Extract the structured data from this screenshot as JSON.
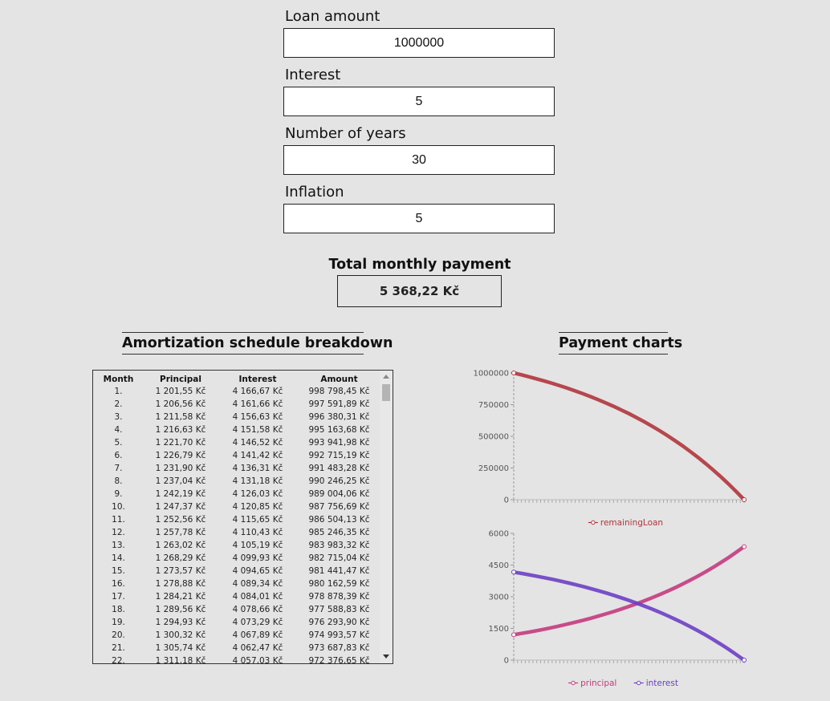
{
  "form": {
    "loan_label": "Loan amount",
    "loan_value": "1000000",
    "interest_label": "Interest",
    "interest_value": "5",
    "years_label": "Number of years",
    "years_value": "30",
    "inflation_label": "Inflation",
    "inflation_value": "5"
  },
  "result": {
    "label": "Total monthly payment",
    "value": "5 368,22 Kč"
  },
  "sections": {
    "amortization_title": "Amortization schedule breakdown",
    "charts_title": "Payment charts"
  },
  "table": {
    "headers": [
      "Month",
      "Principal",
      "Interest",
      "Amount"
    ],
    "rows": [
      [
        "1.",
        "1 201,55 Kč",
        "4 166,67 Kč",
        "998 798,45 Kč"
      ],
      [
        "2.",
        "1 206,56 Kč",
        "4 161,66 Kč",
        "997 591,89 Kč"
      ],
      [
        "3.",
        "1 211,58 Kč",
        "4 156,63 Kč",
        "996 380,31 Kč"
      ],
      [
        "4.",
        "1 216,63 Kč",
        "4 151,58 Kč",
        "995 163,68 Kč"
      ],
      [
        "5.",
        "1 221,70 Kč",
        "4 146,52 Kč",
        "993 941,98 Kč"
      ],
      [
        "6.",
        "1 226,79 Kč",
        "4 141,42 Kč",
        "992 715,19 Kč"
      ],
      [
        "7.",
        "1 231,90 Kč",
        "4 136,31 Kč",
        "991 483,28 Kč"
      ],
      [
        "8.",
        "1 237,04 Kč",
        "4 131,18 Kč",
        "990 246,25 Kč"
      ],
      [
        "9.",
        "1 242,19 Kč",
        "4 126,03 Kč",
        "989 004,06 Kč"
      ],
      [
        "10.",
        "1 247,37 Kč",
        "4 120,85 Kč",
        "987 756,69 Kč"
      ],
      [
        "11.",
        "1 252,56 Kč",
        "4 115,65 Kč",
        "986 504,13 Kč"
      ],
      [
        "12.",
        "1 257,78 Kč",
        "4 110,43 Kč",
        "985 246,35 Kč"
      ],
      [
        "13.",
        "1 263,02 Kč",
        "4 105,19 Kč",
        "983 983,32 Kč"
      ],
      [
        "14.",
        "1 268,29 Kč",
        "4 099,93 Kč",
        "982 715,04 Kč"
      ],
      [
        "15.",
        "1 273,57 Kč",
        "4 094,65 Kč",
        "981 441,47 Kč"
      ],
      [
        "16.",
        "1 278,88 Kč",
        "4 089,34 Kč",
        "980 162,59 Kč"
      ],
      [
        "17.",
        "1 284,21 Kč",
        "4 084,01 Kč",
        "978 878,39 Kč"
      ],
      [
        "18.",
        "1 289,56 Kč",
        "4 078,66 Kč",
        "977 588,83 Kč"
      ],
      [
        "19.",
        "1 294,93 Kč",
        "4 073,29 Kč",
        "976 293,90 Kč"
      ],
      [
        "20.",
        "1 300,32 Kč",
        "4 067,89 Kč",
        "974 993,57 Kč"
      ],
      [
        "21.",
        "1 305,74 Kč",
        "4 062,47 Kč",
        "973 687,83 Kč"
      ],
      [
        "22.",
        "1 311,18 Kč",
        "4 057,03 Kč",
        "972 376,65 Kč"
      ]
    ]
  },
  "chart_data": [
    {
      "type": "line",
      "x": [
        0,
        30
      ],
      "ylim": [
        0,
        1000000
      ],
      "yticks": [
        0,
        250000,
        500000,
        750000,
        1000000
      ],
      "legend_position": "bottom",
      "series": [
        {
          "name": "remainingLoan",
          "color": "#b0353c",
          "values": [
            1000000,
            985246,
            969738,
            953437,
            936302,
            918290,
            899357,
            879456,
            858536,
            836546,
            813430,
            789132,
            763590,
            736742,
            708519,
            678852,
            647668,
            614888,
            580432,
            544212,
            506140,
            466120,
            424052,
            379831,
            333347,
            284486,
            233124,
            179136,
            122384,
            62728,
            0
          ]
        }
      ]
    },
    {
      "type": "line",
      "x": [
        0,
        30
      ],
      "ylim": [
        0,
        6000
      ],
      "yticks": [
        0,
        1500,
        3000,
        4500,
        6000
      ],
      "legend_position": "bottom",
      "series": [
        {
          "name": "principal",
          "color": "#c43a7e",
          "values": [
            1201,
            1263,
            1327,
            1395,
            1467,
            1542,
            1621,
            1704,
            1791,
            1882,
            1979,
            2080,
            2187,
            2299,
            2416,
            2540,
            2670,
            2807,
            2950,
            3101,
            3260,
            3427,
            3603,
            3787,
            3981,
            4185,
            4399,
            4625,
            4861,
            5110,
            5368
          ]
        },
        {
          "name": "interest",
          "color": "#6b3fc4",
          "values": [
            4167,
            4105,
            4041,
            3973,
            3901,
            3826,
            3747,
            3664,
            3577,
            3486,
            3389,
            3288,
            3181,
            3069,
            2952,
            2828,
            2698,
            2561,
            2418,
            2267,
            2108,
            1941,
            1765,
            1581,
            1387,
            1183,
            969,
            743,
            507,
            258,
            0
          ]
        }
      ]
    }
  ]
}
